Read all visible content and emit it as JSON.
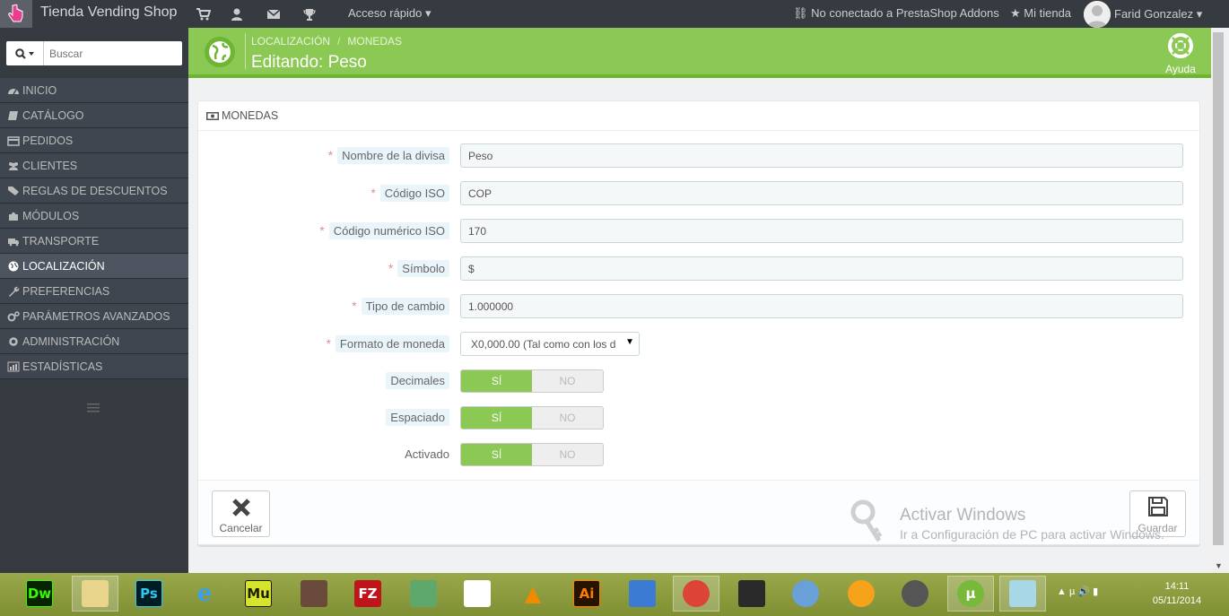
{
  "topbar": {
    "shop_name": "Tienda Vending Shop",
    "quick_access": "Acceso rápido",
    "addons": "No conectado a PrestaShop Addons",
    "my_store": "Mi tienda",
    "user": "Farid Gonzalez"
  },
  "sidebar": {
    "search_placeholder": "Buscar",
    "items": [
      {
        "label": "INICIO",
        "icon": "dashboard-icon"
      },
      {
        "label": "CATÁLOGO",
        "icon": "book-icon"
      },
      {
        "label": "PEDIDOS",
        "icon": "credit-card-icon"
      },
      {
        "label": "CLIENTES",
        "icon": "users-icon"
      },
      {
        "label": "REGLAS DE DESCUENTOS",
        "icon": "tag-icon"
      },
      {
        "label": "MÓDULOS",
        "icon": "puzzle-icon"
      },
      {
        "label": "TRANSPORTE",
        "icon": "truck-icon"
      },
      {
        "label": "LOCALIZACIÓN",
        "icon": "globe-icon"
      },
      {
        "label": "PREFERENCIAS",
        "icon": "wrench-icon"
      },
      {
        "label": "PARÁMETROS AVANZADOS",
        "icon": "cogs-icon"
      },
      {
        "label": "ADMINISTRACIÓN",
        "icon": "cog-icon"
      },
      {
        "label": "ESTADÍSTICAS",
        "icon": "bar-chart-icon"
      }
    ],
    "active": "LOCALIZACIÓN"
  },
  "header": {
    "breadcrumb": [
      "LOCALIZACIÓN",
      "MONEDAS"
    ],
    "title": "Editando: Peso",
    "help_label": "Ayuda"
  },
  "panel": {
    "heading": "MONEDAS",
    "fields": {
      "name": {
        "label": "Nombre de la divisa",
        "value": "Peso"
      },
      "iso": {
        "label": "Código ISO",
        "value": "COP"
      },
      "iso_num": {
        "label": "Código numérico ISO",
        "value": "170"
      },
      "symbol": {
        "label": "Símbolo",
        "value": "$"
      },
      "rate": {
        "label": "Tipo de cambio",
        "value": "1.000000"
      },
      "format": {
        "label": "Formato de moneda",
        "value": "X0,000.00 (Tal como con los d"
      }
    },
    "switches": {
      "decimals": {
        "label": "Decimales",
        "yes": "SÍ",
        "no": "NO",
        "selected": "SÍ"
      },
      "spacing": {
        "label": "Espaciado",
        "yes": "SÍ",
        "no": "NO",
        "selected": "SÍ"
      },
      "active": {
        "label": "Activado",
        "yes": "SÍ",
        "no": "NO",
        "selected": "SÍ"
      }
    },
    "cancel_label": "Cancelar",
    "save_label": "Guardar"
  },
  "watermark": {
    "title": "Activar Windows",
    "subtitle": "Ir a Configuración de PC para activar Windows."
  },
  "taskbar": {
    "apps": [
      {
        "name": "Dw",
        "color": "#35fa00",
        "bg": "#072401"
      },
      {
        "name": "",
        "color": "#000",
        "bg": "#e8d48a"
      },
      {
        "name": "Ps",
        "color": "#31c5f0",
        "bg": "#001d26"
      },
      {
        "name": "e",
        "color": "#3aa0f0",
        "bg": "transparent"
      },
      {
        "name": "Mu",
        "color": "#1d1d00",
        "bg": "#d6e42e"
      },
      {
        "name": "",
        "color": "#000",
        "bg": "#6a4a3a"
      },
      {
        "name": "FZ",
        "color": "#fff",
        "bg": "#c0141b"
      },
      {
        "name": "",
        "color": "#000",
        "bg": "#5fa86b"
      },
      {
        "name": "",
        "color": "#000",
        "bg": "#ffffff"
      },
      {
        "name": "",
        "color": "#000",
        "bg": "#f08a00"
      },
      {
        "name": "Ai",
        "color": "#ff7c00",
        "bg": "#261300"
      },
      {
        "name": "",
        "color": "#000",
        "bg": "#3b7bd4"
      },
      {
        "name": "",
        "color": "#000",
        "bg": "#db4437"
      },
      {
        "name": "",
        "color": "#000",
        "bg": "#2a2a2a"
      },
      {
        "name": "",
        "color": "#000",
        "bg": "#6aa0d8"
      },
      {
        "name": "",
        "color": "#000",
        "bg": "#f7a21b"
      },
      {
        "name": "",
        "color": "#000",
        "bg": "#555555"
      },
      {
        "name": "",
        "color": "#fff",
        "bg": "#78b83a"
      },
      {
        "name": "",
        "color": "#000",
        "bg": "#a8d8e8"
      }
    ],
    "time": "14:11",
    "date": "05/11/2014"
  }
}
